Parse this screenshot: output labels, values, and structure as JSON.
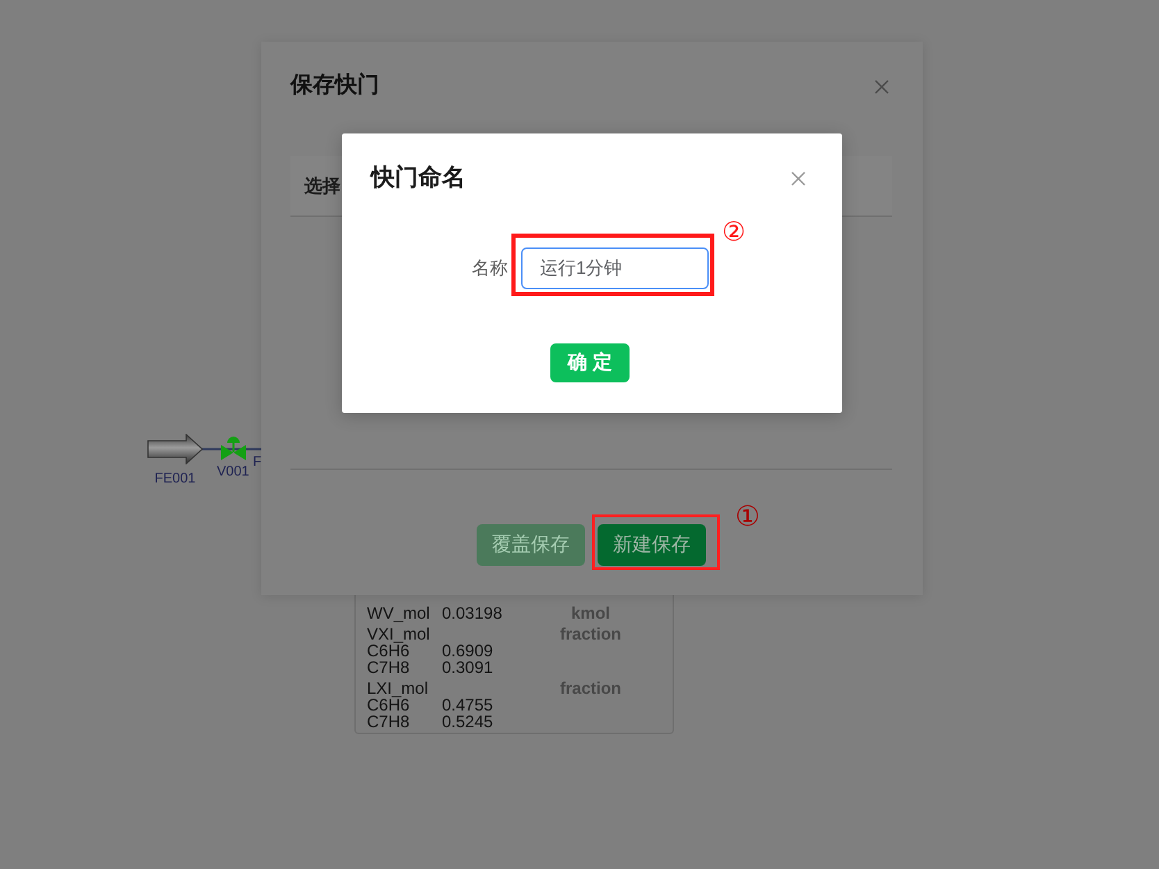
{
  "canvas": {
    "nodes": [
      {
        "kind": "feed",
        "label": "FE001"
      },
      {
        "kind": "valve",
        "label": "V001"
      },
      {
        "kind": "covered",
        "label": "F"
      }
    ]
  },
  "readout": {
    "rows": [
      {
        "kind": "quantity",
        "name": "WV_mol",
        "value": "0.03198",
        "unit": "kmol"
      },
      {
        "kind": "composition",
        "name": "VXI_mol",
        "unit": "fraction"
      },
      {
        "kind": "component",
        "name": "C6H6",
        "value": "0.6909"
      },
      {
        "kind": "component",
        "name": "C7H8",
        "value": "0.3091"
      },
      {
        "kind": "composition",
        "name": "LXI_mol",
        "unit": "fraction"
      },
      {
        "kind": "component",
        "name": "C6H6",
        "value": "0.4755"
      },
      {
        "kind": "component",
        "name": "C7H8",
        "value": "0.5245"
      }
    ]
  },
  "save_dialog": {
    "title": "保存快门",
    "table": {
      "columns": [
        "选择"
      ]
    },
    "buttons": [
      {
        "label": "覆盖保存",
        "disabled": true,
        "highlighted": false
      },
      {
        "label": "新建保存",
        "disabled": false,
        "highlighted": true,
        "callout": "①"
      }
    ]
  },
  "name_dialog": {
    "title": "快门命名",
    "field": {
      "label": "名称",
      "value": "运行1分钟",
      "focused": true,
      "highlighted": true,
      "callout": "②"
    },
    "buttons": [
      {
        "label": "确定"
      }
    ]
  }
}
